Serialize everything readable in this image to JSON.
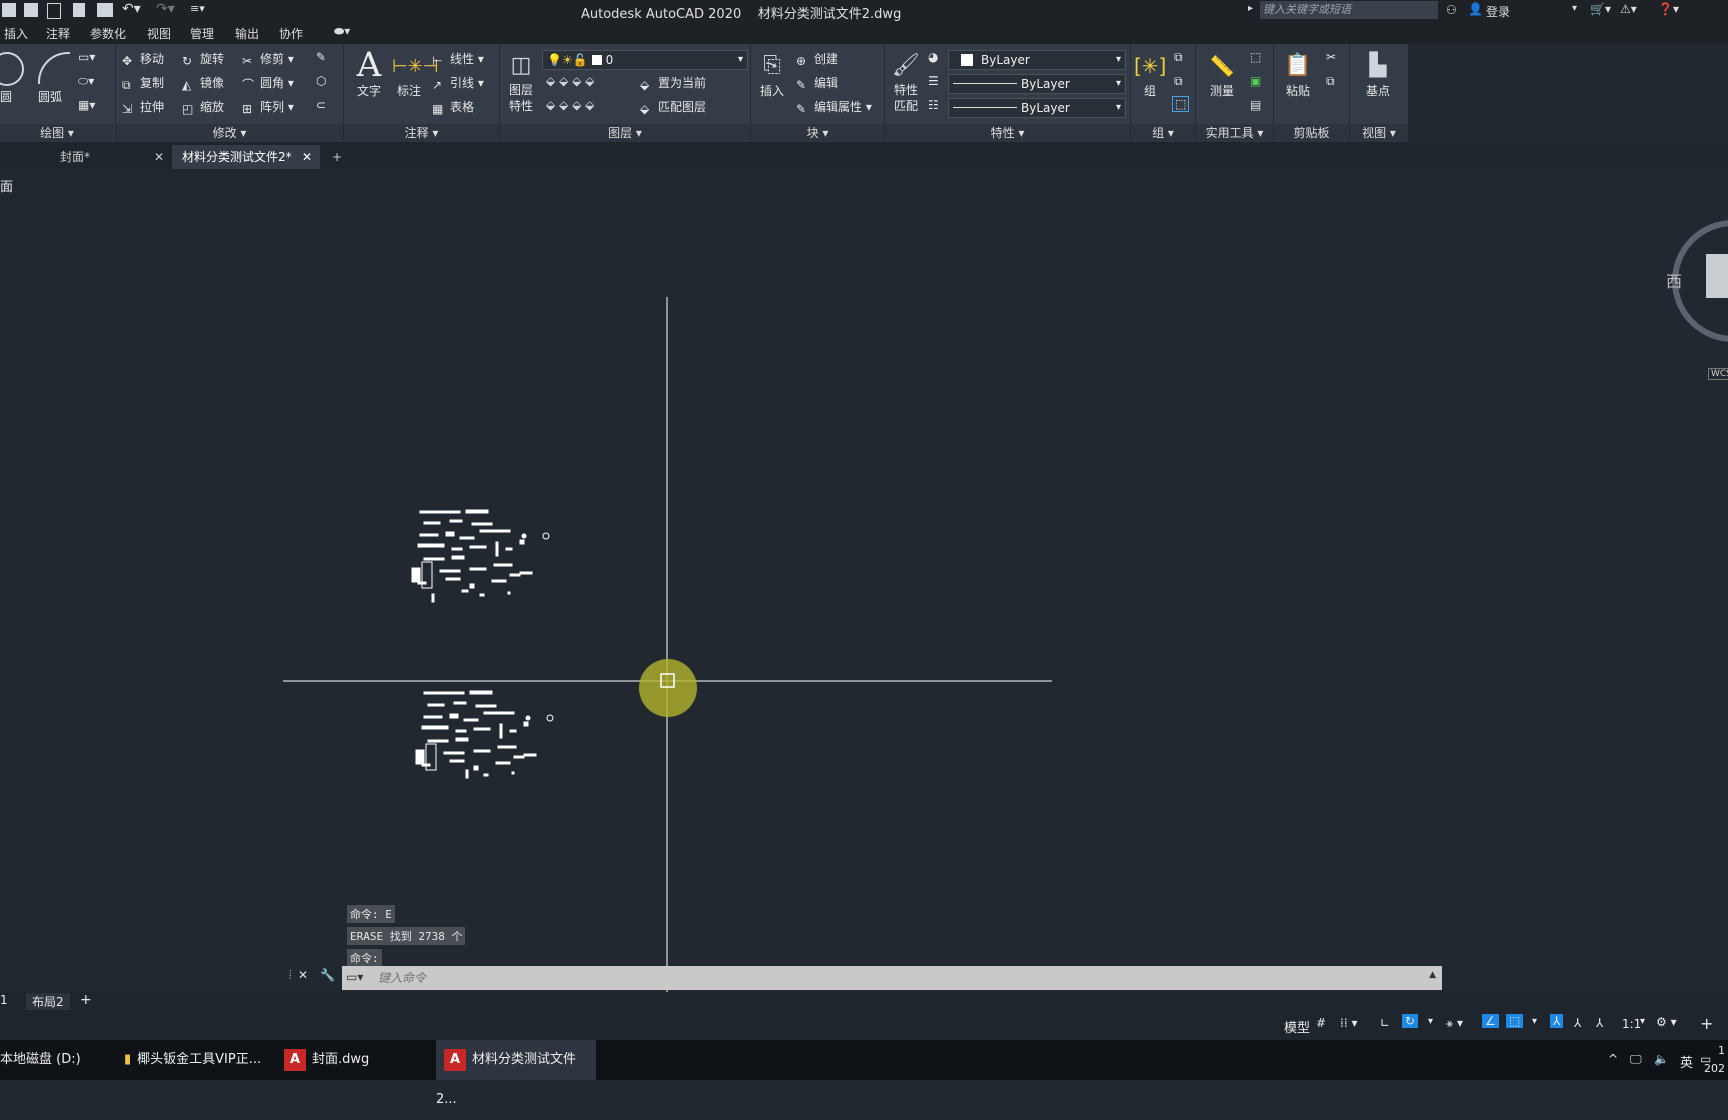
{
  "window": {
    "title": "Autodesk AutoCAD 2020    材料分类测试文件2.dwg",
    "search_placeholder": "键入关键字或短语",
    "login_label": "登录"
  },
  "menu": [
    "插入",
    "注释",
    "参数化",
    "视图",
    "管理",
    "输出",
    "协作"
  ],
  "ribbon": {
    "draw": {
      "circle": "圆",
      "arc": "圆弧",
      "title": "绘图"
    },
    "modify": {
      "move": "移动",
      "rotate": "旋转",
      "trim": "修剪",
      "copy": "复制",
      "mirror": "镜像",
      "fillet": "圆角",
      "stretch": "拉伸",
      "scale": "缩放",
      "array": "阵列",
      "title": "修改"
    },
    "annotation": {
      "text": "文字",
      "dimension": "标注",
      "linear": "线性",
      "leader": "引线",
      "table": "表格",
      "title": "注释"
    },
    "layers": {
      "properties": "图层特性",
      "current_layer": "0",
      "set_current": "置为当前",
      "match_layer": "匹配图层",
      "title": "图层"
    },
    "block": {
      "insert": "插入",
      "create": "创建",
      "edit": "编辑",
      "edit_attributes": "编辑属性",
      "title": "块"
    },
    "properties": {
      "match": "特性匹配",
      "color": "ByLayer",
      "linetype": "ByLayer",
      "lineweight": "ByLayer",
      "title": "特性"
    },
    "groups": {
      "group": "组",
      "title": "组"
    },
    "utilities": {
      "measure": "测量",
      "title": "实用工具"
    },
    "clipboard": {
      "paste": "粘贴",
      "title": "剪贴板"
    },
    "view": {
      "base": "基点",
      "title": "视图"
    }
  },
  "doc_tabs": [
    {
      "label": "封面*"
    },
    {
      "label": "材料分类测试文件2*"
    }
  ],
  "viewport_label": "面",
  "viewcube": {
    "west": "西",
    "wcs": "WCS"
  },
  "command_history": [
    "命令: E",
    "ERASE 找到 2738 个",
    "命令:"
  ],
  "command_placeholder": "键入命令",
  "layout_tabs": [
    "1",
    "布局2"
  ],
  "status": {
    "model": "模型",
    "scale": "1:1"
  },
  "taskbar": {
    "drive": "本地磁盘 (D:)",
    "folder": "椰头钣金工具VIP正...",
    "app1": "封面.dwg",
    "app2": "材料分类测试文件2...",
    "ime": "英",
    "clock_top": "1",
    "clock_bottom": "202"
  },
  "colors": {
    "accent": "#1e88e5",
    "cursor_highlight": "#b3b12a"
  }
}
